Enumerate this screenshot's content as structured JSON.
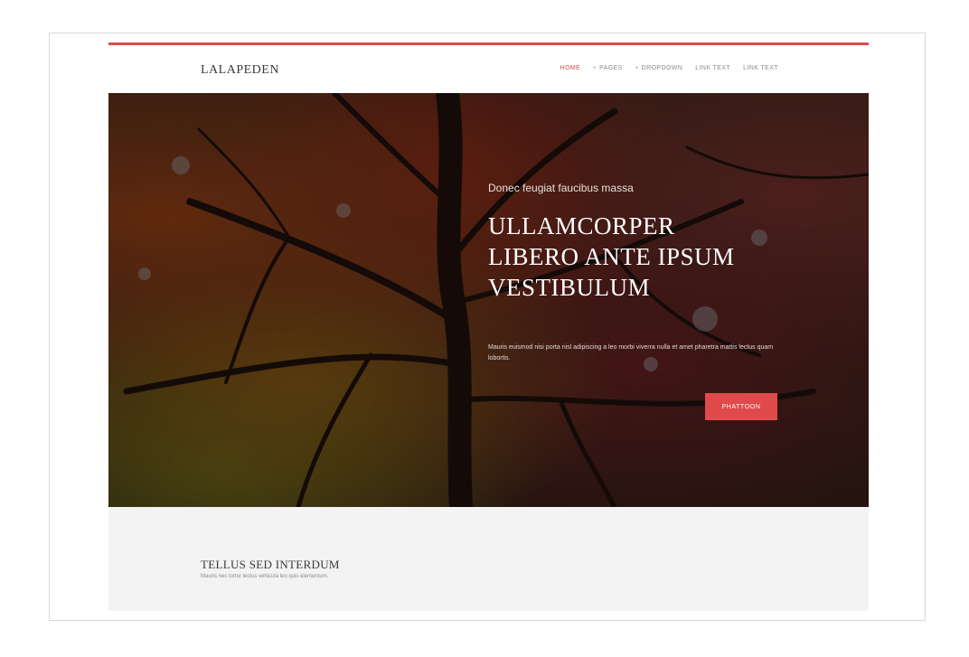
{
  "header": {
    "logo": "LALAPEDEN",
    "nav": [
      {
        "label": "HOME",
        "active": true,
        "caret": ""
      },
      {
        "label": "PAGES",
        "active": false,
        "caret": "+"
      },
      {
        "label": "DROPDOWN",
        "active": false,
        "caret": "+"
      },
      {
        "label": "LINK TEXT",
        "active": false,
        "caret": ""
      },
      {
        "label": "LINK TEXT",
        "active": false,
        "caret": ""
      }
    ]
  },
  "hero": {
    "kicker": "Donec feugiat faucibus massa",
    "title_lines": [
      "ULLAMCORPER",
      "LIBERO ANTE IPSUM",
      "VESTIBULUM"
    ],
    "body": "Mauris euismod nisi porta nisl adipiscing a leo morbi viverra nulla et amet pharetra mattis lectus quam lobortis.",
    "button_label": "PHATTOON"
  },
  "section": {
    "title": "TELLUS SED INTERDUM",
    "subtitle": "Mauris nec tortor lectus vehicula leo quis elementum."
  },
  "colors": {
    "accent": "#e04a4a",
    "section_bg": "#f3f3f3",
    "text_dark": "#3a3a3a"
  }
}
